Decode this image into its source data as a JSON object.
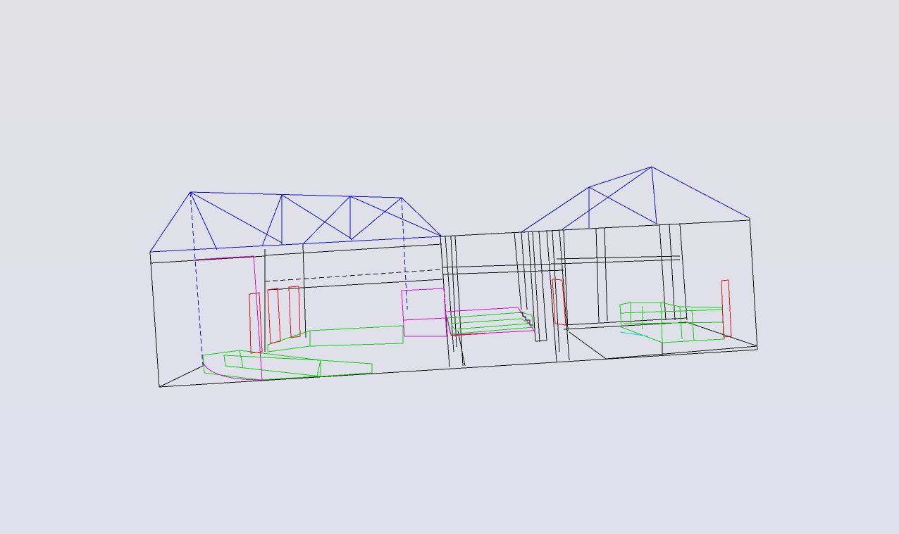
{
  "viewport": {
    "background_top": "#e2e1e6",
    "background_bottom": "#dfe2ee"
  },
  "legend_colors": {
    "roof": "#1010d8",
    "walls": "#101010",
    "furniture": "#10d010",
    "doors": "#d010d0",
    "windows": "#e01010",
    "stairs": "#10d0d0"
  }
}
